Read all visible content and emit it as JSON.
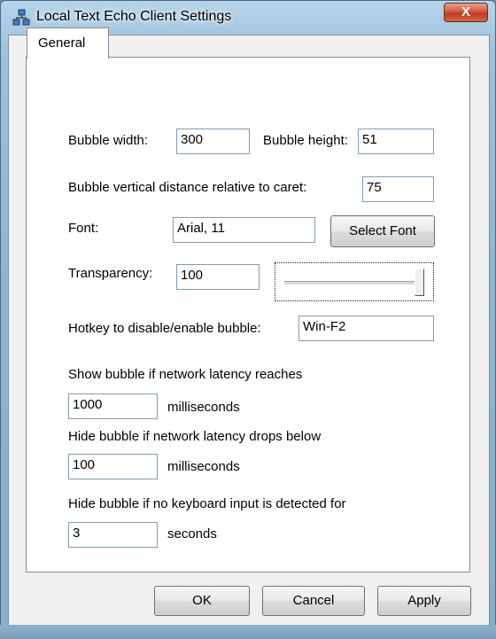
{
  "window": {
    "title": "Local Text Echo Client Settings",
    "close_symbol": "X"
  },
  "tabs": [
    {
      "label": "General"
    }
  ],
  "form": {
    "bubble_width_label": "Bubble width:",
    "bubble_width_value": "300",
    "bubble_height_label": "Bubble height:",
    "bubble_height_value": "51",
    "vertical_distance_label": "Bubble vertical distance relative to caret:",
    "vertical_distance_value": "75",
    "font_label": "Font:",
    "font_value": "Arial, 11",
    "select_font_button": "Select Font",
    "transparency_label": "Transparency:",
    "transparency_value": "100",
    "transparency_slider_fraction": 1.0,
    "hotkey_label": "Hotkey to disable/enable bubble:",
    "hotkey_value": "Win-F2",
    "show_latency_label": "Show bubble if network latency reaches",
    "show_latency_value": "1000",
    "show_latency_unit": "milliseconds",
    "hide_latency_label": "Hide bubble if network latency drops below",
    "hide_latency_value": "100",
    "hide_latency_unit": "milliseconds",
    "hide_idle_label": "Hide bubble if no keyboard input is detected for",
    "hide_idle_value": "3",
    "hide_idle_unit": "seconds"
  },
  "buttons": {
    "ok": "OK",
    "cancel": "Cancel",
    "apply": "Apply"
  }
}
